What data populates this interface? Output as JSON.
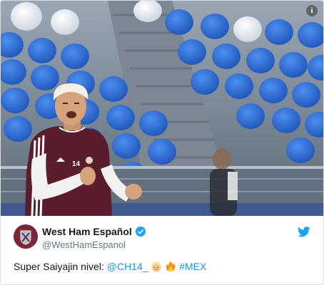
{
  "tweet": {
    "author_name": "West Ham Español",
    "author_handle": "@WestHamEspanol",
    "text_prefix": "Super Saiyajin nivel: ",
    "mention": "@CH14_",
    "hashtag": "#MEX",
    "emojis": [
      "blond-person-emoji",
      "fire-emoji"
    ],
    "jersey_number": "14"
  },
  "media": {
    "info_label": "i"
  },
  "colors": {
    "link": "#1b95e0",
    "avatar_bg": "#7a2640",
    "seat_blue": "#2f6fd6",
    "jersey": "#5a1d2c"
  },
  "icons": {
    "info": "info-icon",
    "verified": "verified-badge-icon",
    "brand": "twitter-bird-icon"
  }
}
